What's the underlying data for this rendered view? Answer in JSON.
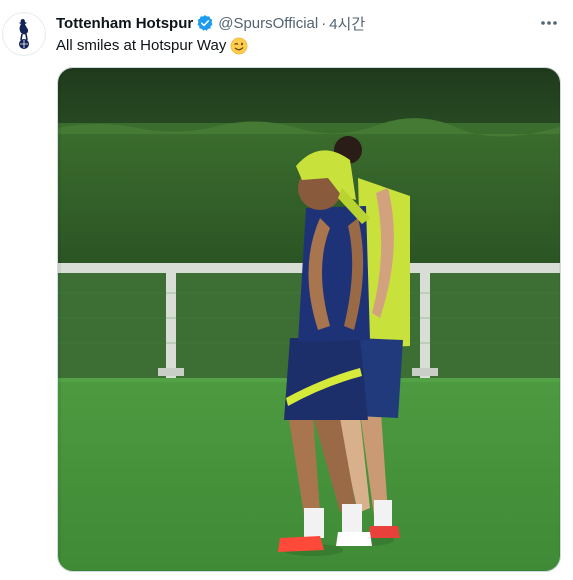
{
  "tweet": {
    "display_name": "Tottenham Hotspur",
    "handle": "@SpursOfficial",
    "separator": "·",
    "time": "4시간",
    "text": "All smiles at Hotspur Way",
    "emoji": "winking-face-icon",
    "verified": true,
    "more_icon": "more-icon",
    "avatar_icon": "spurs-cockerel-logo"
  },
  "media": {
    "type": "video-still"
  },
  "colors": {
    "verified_blue": "#1d9bf0",
    "muted_text": "#536471",
    "grass": "#4f9a45",
    "hedge": "#2f5a26",
    "bib_yellow": "#cfe33a"
  }
}
